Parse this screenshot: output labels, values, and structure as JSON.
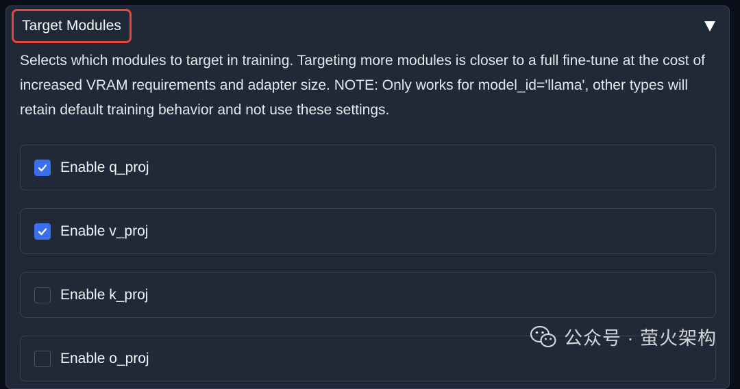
{
  "section": {
    "title": "Target Modules",
    "description": "Selects which modules to target in training. Targeting more modules is closer to a full fine-tune at the cost of increased VRAM requirements and adapter size. NOTE: Only works for model_id='llama', other types will retain default training behavior and not use these settings.",
    "collapse_icon": "triangle-down-icon"
  },
  "options": [
    {
      "label": "Enable q_proj",
      "checked": true
    },
    {
      "label": "Enable v_proj",
      "checked": true
    },
    {
      "label": "Enable k_proj",
      "checked": false
    },
    {
      "label": "Enable o_proj",
      "checked": false
    }
  ],
  "watermark": {
    "text": "公众号 · 萤火架构",
    "icon": "wechat-icon"
  },
  "colors": {
    "panel_bg": "#1f2937",
    "page_bg": "#0b0f19",
    "checkbox_checked": "#3b6ff2",
    "highlight_border": "#e8463a"
  }
}
